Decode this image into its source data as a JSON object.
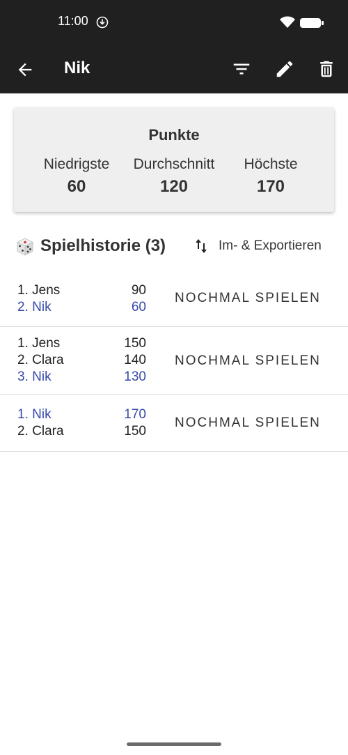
{
  "status": {
    "time": "11:00"
  },
  "appbar": {
    "title": "Nik"
  },
  "stats": {
    "heading": "Punkte",
    "min_label": "Niedrigste",
    "min_value": "60",
    "avg_label": "Durchschnitt",
    "avg_value": "120",
    "max_label": "Höchste",
    "max_value": "170"
  },
  "history": {
    "title": "Spielhistorie (3)",
    "export_label": "Im- & Exportieren",
    "replay_label": "NOCHMAL SPIELEN",
    "games": [
      {
        "players": [
          {
            "name": "1. Jens",
            "score": "90",
            "me": false
          },
          {
            "name": "2. Nik",
            "score": "60",
            "me": true
          }
        ]
      },
      {
        "players": [
          {
            "name": "1. Jens",
            "score": "150",
            "me": false
          },
          {
            "name": "2. Clara",
            "score": "140",
            "me": false
          },
          {
            "name": "3. Nik",
            "score": "130",
            "me": true
          }
        ]
      },
      {
        "players": [
          {
            "name": "1. Nik",
            "score": "170",
            "me": true
          },
          {
            "name": "2. Clara",
            "score": "150",
            "me": false
          }
        ]
      }
    ]
  },
  "colors": {
    "appbar": "#202020",
    "highlight": "#3949ab",
    "card": "#efefef"
  },
  "icons": [
    "download-status-icon",
    "wifi-icon",
    "battery-icon",
    "back-arrow-icon",
    "filter-icon",
    "edit-pencil-icon",
    "delete-icon",
    "dice-icon",
    "sort-icon"
  ]
}
